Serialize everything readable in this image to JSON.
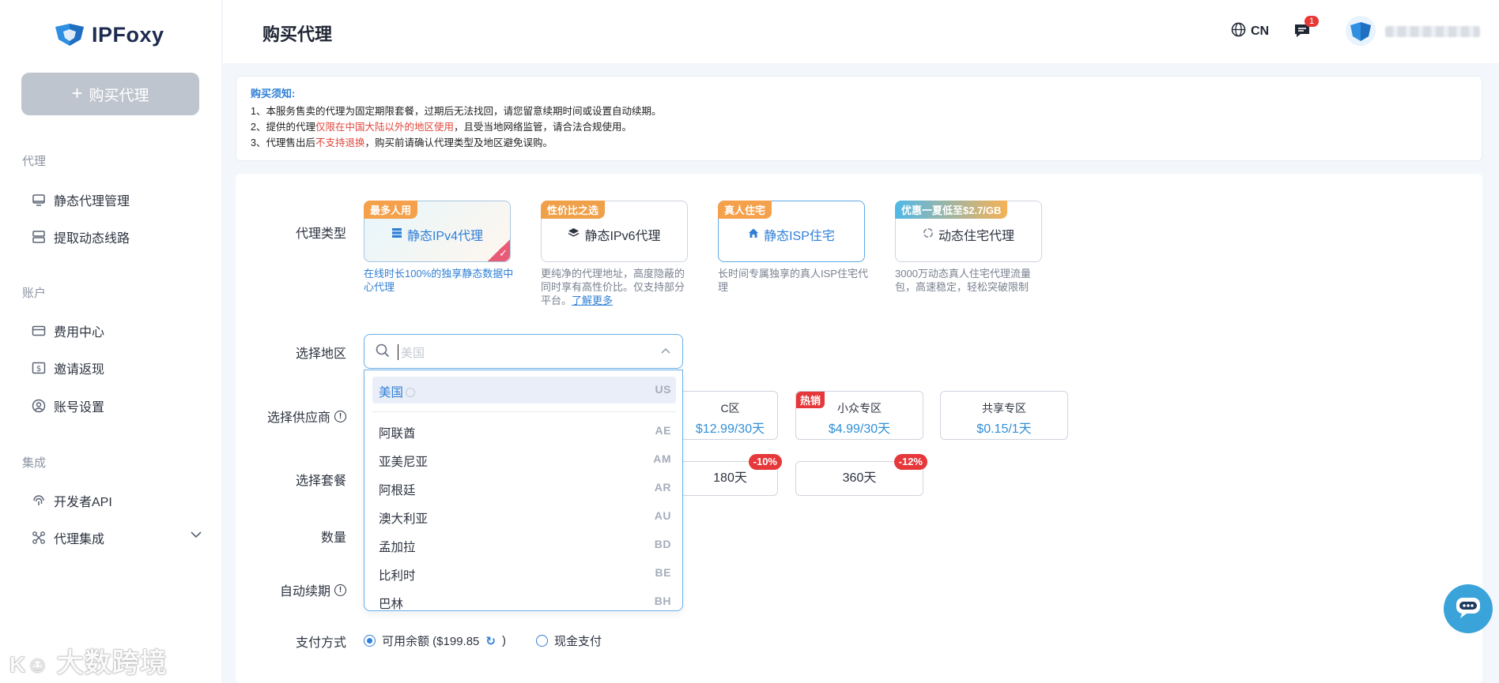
{
  "brand": {
    "name": "IPFoxy"
  },
  "sidebar": {
    "buy_button": "购买代理",
    "sections": [
      {
        "title": "代理",
        "items": [
          "静态代理管理",
          "提取动态线路"
        ]
      },
      {
        "title": "账户",
        "items": [
          "费用中心",
          "邀请返现",
          "账号设置"
        ]
      },
      {
        "title": "集成",
        "items": [
          "开发者API",
          "代理集成"
        ]
      }
    ]
  },
  "header": {
    "title": "购买代理",
    "lang": "CN",
    "message_count": "1"
  },
  "notice": {
    "title": "购买须知:",
    "line1": "1、本服务售卖的代理为固定期限套餐，过期后无法找回，请您留意续期时间或设置自动续期。",
    "line2_a": "2、提供的代理",
    "line2_red": "仅限在中国大陆以外的地区使用",
    "line2_b": "，且受当地网络监管，请合法合规使用。",
    "line3_a": "3、代理售出后",
    "line3_red": "不支持退换",
    "line3_b": "，购买前请确认代理类型及地区避免误购。"
  },
  "form": {
    "proxy_type_label": "代理类型",
    "region_label": "选择地区",
    "provider_label": "选择供应商",
    "plan_label": "选择套餐",
    "quantity_label": "数量",
    "auto_renew_label": "自动续期",
    "payment_label": "支付方式"
  },
  "proxy_types": [
    {
      "tag": "最多人用",
      "name": "静态IPv4代理",
      "desc": "在线时长100%的独享静态数据中心代理"
    },
    {
      "tag": "性价比之选",
      "name": "静态IPv6代理",
      "desc": "更纯净的代理地址，高度隐蔽的同时享有高性价比。仅支持部分平台。",
      "link": "了解更多"
    },
    {
      "tag": "真人住宅",
      "name": "静态ISP住宅",
      "desc": "长时间专属独享的真人ISP住宅代理"
    },
    {
      "tag": "优惠一夏低至$2.7/GB",
      "name": "动态住宅代理",
      "desc": "3000万动态真人住宅代理流量包，高速稳定，轻松突破限制"
    }
  ],
  "region": {
    "placeholder": "美国",
    "options": [
      {
        "name": "美国",
        "code": "US"
      },
      {
        "name": "阿联酋",
        "code": "AE"
      },
      {
        "name": "亚美尼亚",
        "code": "AM"
      },
      {
        "name": "阿根廷",
        "code": "AR"
      },
      {
        "name": "澳大利亚",
        "code": "AU"
      },
      {
        "name": "孟加拉",
        "code": "BD"
      },
      {
        "name": "比利时",
        "code": "BE"
      },
      {
        "name": "巴林",
        "code": "BH"
      }
    ]
  },
  "providers": [
    {
      "name": "C区",
      "price": "$12.99/30天"
    },
    {
      "tag": "热销",
      "name": "小众专区",
      "price": "$4.99/30天"
    },
    {
      "name": "共享专区",
      "price": "$0.15/1天"
    }
  ],
  "plans": [
    {
      "name": "180天",
      "discount": "-10%"
    },
    {
      "name": "360天",
      "discount": "-12%"
    }
  ],
  "payment": {
    "balance_label": "可用余额 ($199.85",
    "balance_close": ")",
    "cash_label": "现金支付"
  },
  "watermark": "大数跨境"
}
